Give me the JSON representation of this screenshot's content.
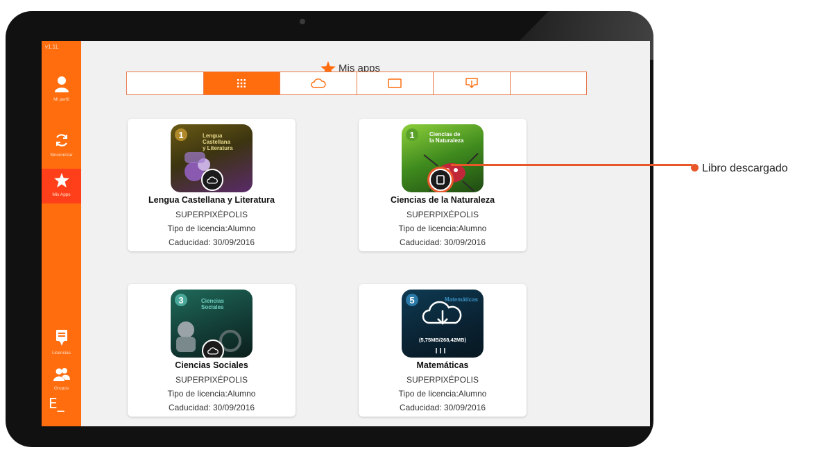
{
  "app": {
    "version": "v1.1L",
    "title": "Mis apps",
    "logo": "E_"
  },
  "sidebar": {
    "items": [
      {
        "label": "Mi perfil",
        "icon": "user-icon"
      },
      {
        "label": "Sincronizar",
        "icon": "sync-icon"
      },
      {
        "label": "Mis Apps",
        "icon": "star-icon",
        "active": true
      },
      {
        "label": "Licencias",
        "icon": "license-icon"
      },
      {
        "label": "Grupos",
        "icon": "group-icon"
      }
    ]
  },
  "tabs": [
    {
      "icon": "",
      "name": "tab-empty-left"
    },
    {
      "icon": "grid-icon",
      "active": true
    },
    {
      "icon": "cloud-icon"
    },
    {
      "icon": "tablet-icon"
    },
    {
      "icon": "download-icon"
    },
    {
      "icon": "",
      "name": "tab-empty-right"
    }
  ],
  "cards": [
    {
      "title": "Lengua Castellana y Literatura",
      "publisher": "SUPERPIXÉPOLIS",
      "license": "Tipo de licencia:Alumno",
      "expiry": "Caducidad: 30/09/2016",
      "cover_number": "1",
      "cover_text": [
        "Lengua",
        "Castellana",
        "y Literatura"
      ],
      "status_icon": "cloud-icon"
    },
    {
      "title": "Ciencias de la Naturaleza",
      "publisher": "SUPERPIXÉPOLIS",
      "license": "Tipo de licencia:Alumno",
      "expiry": "Caducidad: 30/09/2016",
      "cover_number": "1",
      "cover_text": [
        "Ciencias de",
        "la Naturaleza"
      ],
      "status_icon": "tablet-icon"
    },
    {
      "title": "Ciencias Sociales",
      "publisher": "SUPERPIXÉPOLIS",
      "license": "Tipo de licencia:Alumno",
      "expiry": "Caducidad: 30/09/2016",
      "cover_number": "3",
      "cover_text": [
        "Ciencias",
        "Sociales"
      ],
      "status_icon": "cloud-icon"
    },
    {
      "title": "Matemáticas",
      "publisher": "SUPERPIXÉPOLIS",
      "license": "Tipo de licencia:Alumno",
      "expiry": "Caducidad: 30/09/2016",
      "cover_number": "5",
      "cover_text": [
        "Matemáticas"
      ],
      "download_progress": "(5,75MB/268,42MB)",
      "status_icon": "cloud-download-icon"
    }
  ],
  "callout": {
    "label": "Libro descargado"
  },
  "colors": {
    "accent": "#ff6d0f",
    "active_sidebar": "#ff3f1a",
    "callout": "#e8572a"
  }
}
